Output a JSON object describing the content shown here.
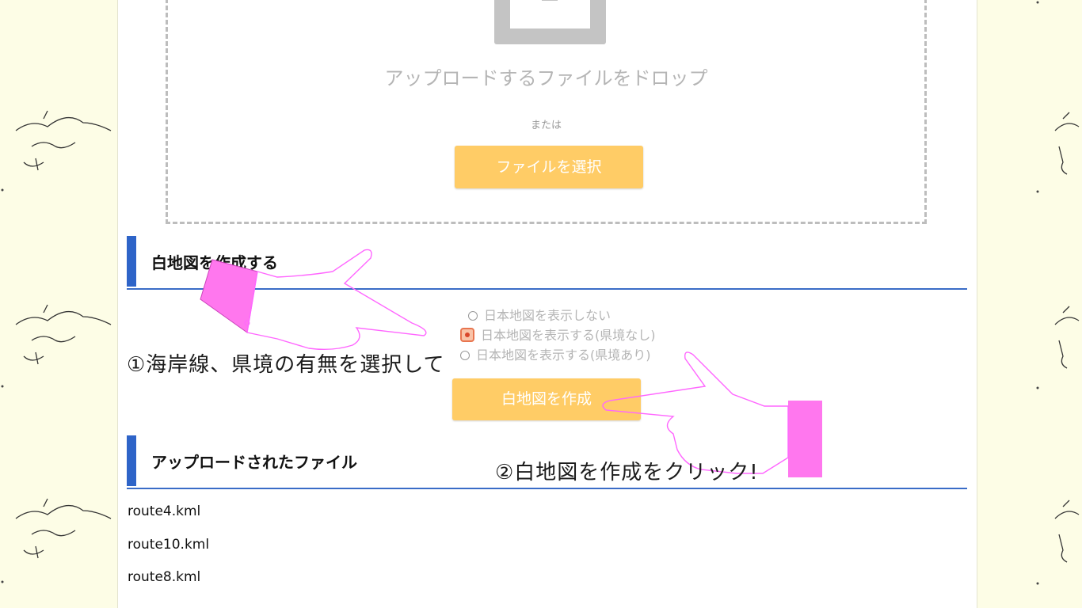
{
  "dropzone": {
    "drop_text": "アップロードするファイルをドロップ",
    "or_text": "または",
    "select_button": "ファイルを選択"
  },
  "create_section": {
    "title": "白地図を作成する",
    "options": [
      {
        "label": "日本地図を表示しない",
        "selected": false
      },
      {
        "label": "日本地図を表示する(県境なし)",
        "selected": true
      },
      {
        "label": "日本地図を表示する(県境あり)",
        "selected": false
      }
    ],
    "create_button": "白地図を作成"
  },
  "uploaded_section": {
    "title": "アップロードされたファイル",
    "files": [
      "route4.kml",
      "route10.kml",
      "route8.kml"
    ]
  },
  "annotations": {
    "step1": "①海岸線、県境の有無を選択して",
    "step2": "②白地図を作成をクリック!"
  },
  "colors": {
    "page_bg": "#fdfde6",
    "button": "#ffcc66",
    "accent_bar": "#2e64c8",
    "hand_outline": "#ff66ff",
    "hand_cuff": "#ff77ee"
  }
}
